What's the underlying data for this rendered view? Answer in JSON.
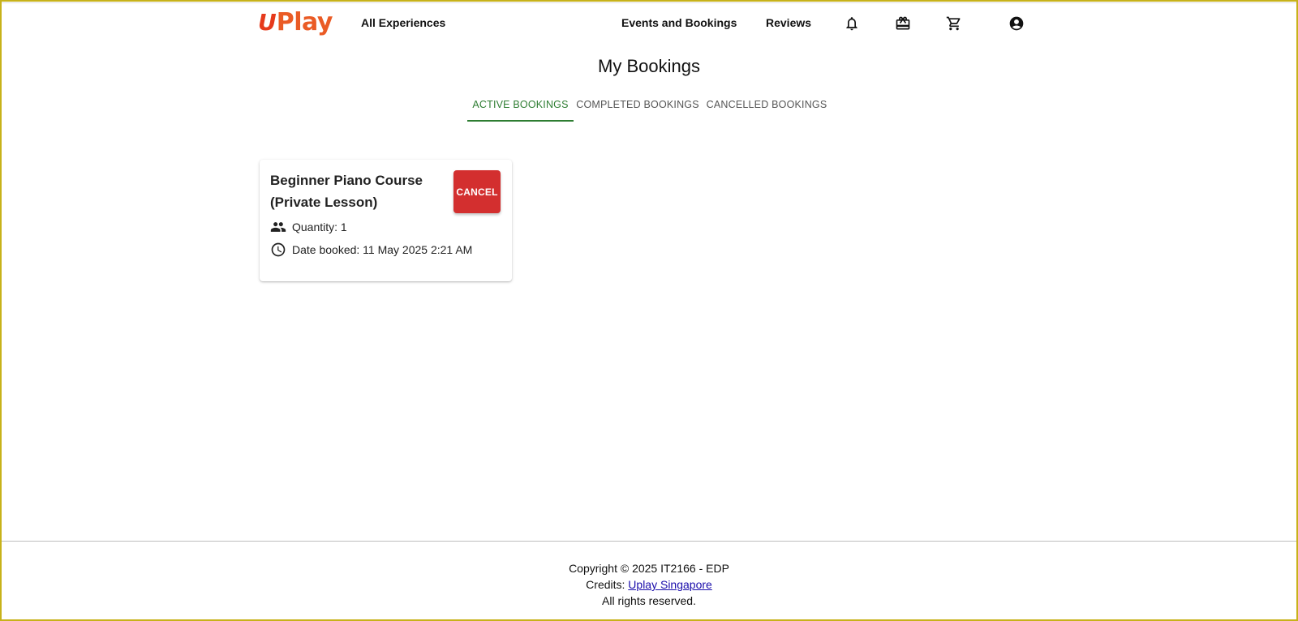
{
  "brand": {
    "logo_mark": "U",
    "logo_text": "Play",
    "logo_color": "#ea5b25"
  },
  "nav": {
    "all_experiences": "All Experiences",
    "events_bookings": "Events and Bookings",
    "reviews": "Reviews",
    "icons": [
      "bell-icon",
      "gift-card-icon",
      "cart-icon",
      "account-icon"
    ]
  },
  "page": {
    "title": "My Bookings"
  },
  "tabs": [
    {
      "label": "ACTIVE BOOKINGS",
      "active": true
    },
    {
      "label": "COMPLETED BOOKINGS",
      "active": false
    },
    {
      "label": "CANCELLED BOOKINGS",
      "active": false
    }
  ],
  "bookings": [
    {
      "title_line1": "Beginner Piano Course",
      "title_line2": "(Private Lesson)",
      "cancel_label": "CANCEL",
      "quantity_text": "Quantity: 1",
      "date_text": "Date booked: 11 May 2025 2:21 AM"
    }
  ],
  "footer": {
    "copyright": "Copyright © 2025 IT2166 - EDP",
    "credits_prefix": "Credits: ",
    "credits_link": "Uplay Singapore",
    "rights": "All rights reserved."
  },
  "colors": {
    "accent_green": "#2e7d32",
    "cancel_red": "#d32f2f",
    "frame_border": "#c7b21a"
  }
}
